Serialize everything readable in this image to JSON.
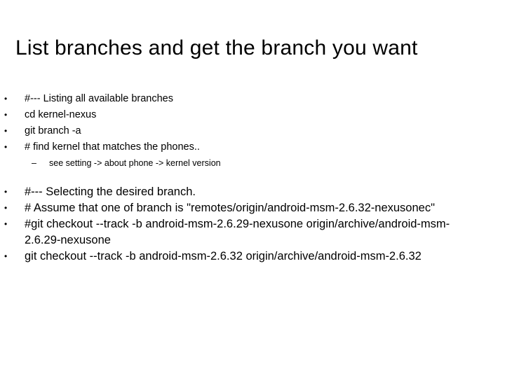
{
  "slide": {
    "title": "List branches and get the branch you want"
  },
  "section_listing": {
    "bullet_glyph": "•",
    "items": [
      {
        "text": "#--- Listing all available branches"
      },
      {
        "text": "cd kernel-nexus"
      },
      {
        "text": "git branch -a"
      },
      {
        "text": "# find kernel that matches the phones.."
      }
    ],
    "sub_items": [
      {
        "dash": "–",
        "text": "see setting -> about phone -> kernel version"
      }
    ]
  },
  "section_selecting": {
    "bullet_glyph": "•",
    "items": [
      {
        "text": "#--- Selecting the desired branch."
      },
      {
        "text": "# Assume that one of branch is \"remotes/origin/android-msm-2.6.32-nexusonec\""
      },
      {
        "text": "#git checkout --track -b android-msm-2.6.29-nexusone origin/archive/android-msm-2.6.29-nexusone"
      },
      {
        "text": "git checkout --track -b android-msm-2.6.32 origin/archive/android-msm-2.6.32"
      }
    ]
  }
}
